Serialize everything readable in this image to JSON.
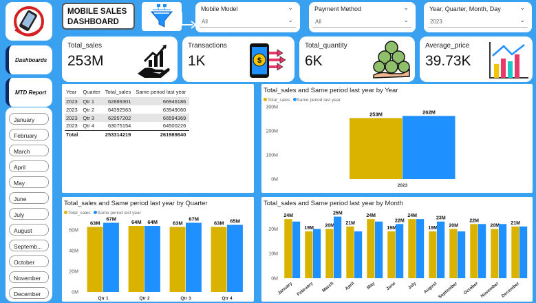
{
  "colors": {
    "sales": "#d9b300",
    "same_period": "#1e90ff",
    "nav_accent": "#0a2a66"
  },
  "header": {
    "title_line1": "MOBILE SALES",
    "title_line2": "DASHBOARD",
    "filter_icon": "funnel-flowchart-icon",
    "slicers": [
      {
        "label": "Mobile Model",
        "value": "All"
      },
      {
        "label": "Payment Method",
        "value": "All"
      },
      {
        "label": "Year, Quarter, Month, Day",
        "value": "2023"
      }
    ]
  },
  "sidebar": {
    "logo_icon": "mobile-phone-logo-icon",
    "nav": [
      {
        "label": "Dashboards"
      },
      {
        "label": "MTD Report"
      }
    ],
    "months": [
      "January",
      "February",
      "March",
      "April",
      "May",
      "June",
      "July",
      "August",
      "Septemb...",
      "October",
      "November",
      "December"
    ]
  },
  "kpis": [
    {
      "label": "Total_sales",
      "value": "253M",
      "icon": "growth-hand-chart-icon"
    },
    {
      "label": "Transactions",
      "value": "1K",
      "icon": "mobile-payment-icon"
    },
    {
      "label": "Total_quantity",
      "value": "6K",
      "icon": "money-bags-hand-icon"
    },
    {
      "label": "Average_price",
      "value": "39.73K",
      "icon": "bar-chart-trend-icon"
    }
  ],
  "table": {
    "headers": [
      "Year",
      "Quarter",
      "Total_sales",
      "Same period last year"
    ],
    "rows": [
      [
        "2023",
        "Qtr 1",
        "62889301",
        "66946186"
      ],
      [
        "2023",
        "Qtr 2",
        "64392563",
        "63949060"
      ],
      [
        "2023",
        "Qtr 3",
        "62957202",
        "66594369"
      ],
      [
        "2023",
        "Qtr 4",
        "63075154",
        "64500226"
      ]
    ],
    "total": [
      "Total",
      "",
      "253314219",
      "261989840"
    ]
  },
  "chart_data": [
    {
      "type": "bar",
      "title": "Total_sales and Same period last year by Year",
      "legend": [
        "Total_sales",
        "Same period last year"
      ],
      "categories": [
        "2023"
      ],
      "series": [
        {
          "name": "Total_sales",
          "values": [
            253
          ],
          "labels": [
            "253M"
          ]
        },
        {
          "name": "Same period last year",
          "values": [
            262
          ],
          "labels": [
            "262M"
          ]
        }
      ],
      "ylim": [
        0,
        300
      ],
      "yticks": [
        {
          "value": 0,
          "label": "0M"
        },
        {
          "value": 100,
          "label": "100M"
        },
        {
          "value": 200,
          "label": "200M"
        },
        {
          "value": 300,
          "label": "300M"
        }
      ]
    },
    {
      "type": "bar",
      "title": "Total_sales and Same period last year by Quarter",
      "legend": [
        "Total_sales",
        "Same period last year"
      ],
      "categories": [
        "Qtr 1",
        "Qtr 2",
        "Qtr 3",
        "Qtr 4"
      ],
      "series": [
        {
          "name": "Total_sales",
          "values": [
            63,
            64,
            63,
            63
          ],
          "labels": [
            "63M",
            "64M",
            "63M",
            "63M"
          ]
        },
        {
          "name": "Same period last year",
          "values": [
            67,
            64,
            67,
            65
          ],
          "labels": [
            "67M",
            "64M",
            "67M",
            "65M"
          ]
        }
      ],
      "ylim": [
        0,
        70
      ],
      "yticks": [
        {
          "value": 0,
          "label": "0M"
        },
        {
          "value": 20,
          "label": "20M"
        },
        {
          "value": 40,
          "label": "40M"
        },
        {
          "value": 60,
          "label": "60M"
        }
      ]
    },
    {
      "type": "bar",
      "title": "Total_sales and Same period last year by Month",
      "legend": [],
      "categories": [
        "January",
        "February",
        "March",
        "April",
        "May",
        "June",
        "July",
        "August",
        "September",
        "October",
        "November",
        "December"
      ],
      "series": [
        {
          "name": "Total_sales",
          "values": [
            24,
            19,
            20,
            21,
            24,
            19,
            24,
            19,
            20,
            22,
            20,
            21
          ],
          "labels": [
            "24M",
            "19M",
            "20M",
            "21M",
            "24M",
            "19M",
            "24M",
            "19M",
            "20M",
            "22M",
            "20M",
            "21M"
          ]
        },
        {
          "name": "Same period last year",
          "values": [
            23,
            20,
            25,
            19,
            23,
            22,
            24,
            23,
            19,
            22,
            22,
            21
          ],
          "labels": [
            "",
            "",
            "25M",
            "",
            "",
            "22M",
            "",
            "23M",
            "",
            "",
            "",
            ""
          ]
        }
      ],
      "ylim": [
        0,
        26
      ],
      "yticks": [
        {
          "value": 0,
          "label": "0M"
        },
        {
          "value": 10,
          "label": "10M"
        },
        {
          "value": 20,
          "label": "20M"
        }
      ]
    }
  ]
}
